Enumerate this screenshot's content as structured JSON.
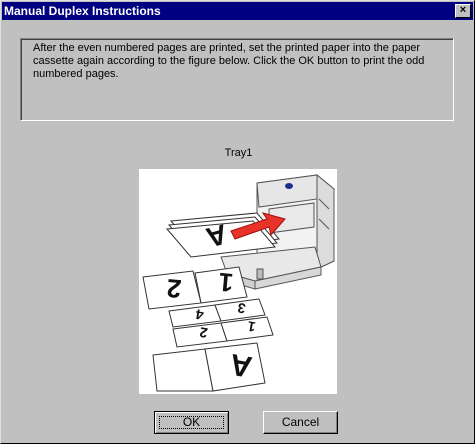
{
  "window": {
    "title": "Manual Duplex Instructions",
    "close_glyph": "×"
  },
  "instructions": {
    "text": "After the even numbered pages are printed, set the printed paper into the paper cassette again according to the figure below. Click the OK button to print the odd numbered pages."
  },
  "figure": {
    "tray_label": "Tray1",
    "printer_accent_color": "#1a2f8a",
    "arrow_color": "#e8322a",
    "pages": [
      "A",
      "1",
      "2",
      "3",
      "4",
      "1",
      "2",
      "A"
    ]
  },
  "buttons": {
    "ok_label": "OK",
    "cancel_label": "Cancel"
  }
}
